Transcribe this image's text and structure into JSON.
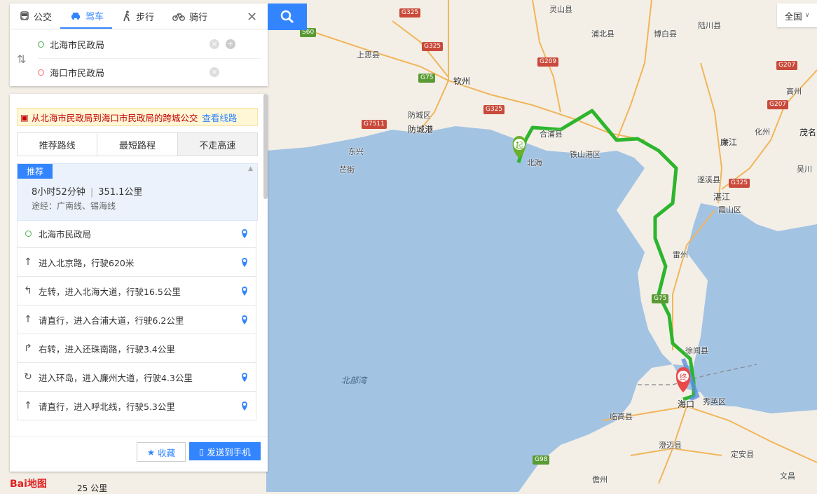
{
  "search": {
    "modes": [
      "公交",
      "驾车",
      "步行",
      "骑行"
    ],
    "active_mode": "驾车",
    "origin": "北海市民政局",
    "destination": "海口市民政局"
  },
  "panel": {
    "notice_text": "从北海市民政局到海口市民政局的跨城公交",
    "notice_link": "查看线路",
    "tabs": [
      "推荐路线",
      "最短路程",
      "不走高速"
    ],
    "recommend_badge": "推荐",
    "duration": "8小时52分钟",
    "distance": "351.1公里",
    "via": "途经：广南线、锡海线",
    "steps": [
      {
        "icon": "start-circle-icon",
        "text": "北海市民政局",
        "pin": true
      },
      {
        "icon": "straight-arrow-icon",
        "text": "进入北京路，行驶620米",
        "pin": true
      },
      {
        "icon": "turn-left-icon",
        "text": "左转，进入北海大道，行驶16.5公里",
        "pin": true
      },
      {
        "icon": "straight-arrow-icon",
        "text": "请直行，进入合浦大道，行驶6.2公里",
        "pin": true
      },
      {
        "icon": "turn-right-icon",
        "text": "右转，进入还珠南路，行驶3.4公里",
        "pin": false
      },
      {
        "icon": "roundabout-icon",
        "text": "进入环岛，进入廉州大道，行驶4.3公里",
        "pin": true
      },
      {
        "icon": "straight-arrow-icon",
        "text": "请直行，进入呼北线，行驶5.3公里",
        "pin": true
      }
    ],
    "fav_label": "收藏",
    "send_label": "发送到手机"
  },
  "map": {
    "region_label": "全国",
    "start_marker": "起",
    "end_marker": "终",
    "sea_label": "北部湾",
    "labels": [
      {
        "text": "灵山县"
      },
      {
        "text": "浦北县"
      },
      {
        "text": "博白县"
      },
      {
        "text": "陆川县"
      },
      {
        "text": "上思县"
      },
      {
        "text": "钦州"
      },
      {
        "text": "防城区"
      },
      {
        "text": "防城港"
      },
      {
        "text": "东兴"
      },
      {
        "text": "芒街"
      },
      {
        "text": "合浦县"
      },
      {
        "text": "铁山港区"
      },
      {
        "text": "北海"
      },
      {
        "text": "廉江"
      },
      {
        "text": "遂溪县"
      },
      {
        "text": "湛江"
      },
      {
        "text": "霞山区"
      },
      {
        "text": "雷州"
      },
      {
        "text": "徐闻县"
      },
      {
        "text": "海口"
      },
      {
        "text": "秀英区"
      },
      {
        "text": "临高县"
      },
      {
        "text": "澄迈县"
      },
      {
        "text": "定安县"
      },
      {
        "text": "儋州"
      },
      {
        "text": "文昌"
      },
      {
        "text": "化州"
      },
      {
        "text": "茂名"
      },
      {
        "text": "高州"
      },
      {
        "text": "吴川"
      }
    ],
    "shields": [
      "G325",
      "G325",
      "G209",
      "G75",
      "S60",
      "G325",
      "G7511",
      "G207",
      "G207",
      "G325",
      "G75",
      "G98"
    ],
    "logo": "Bai地图",
    "scale": "25 公里"
  }
}
